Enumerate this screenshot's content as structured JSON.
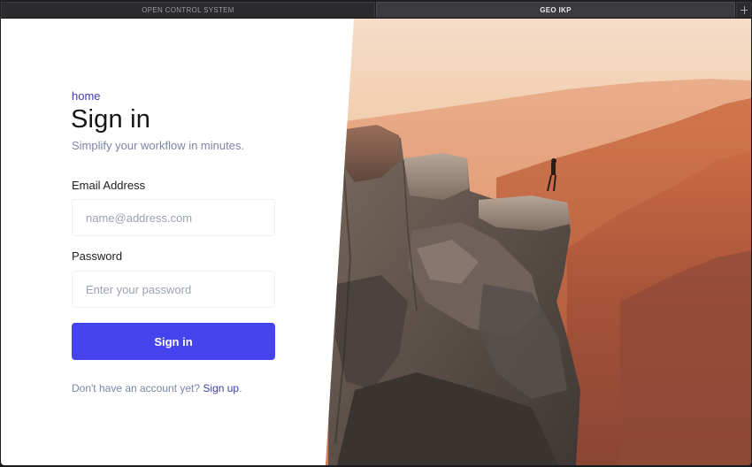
{
  "tabs": [
    {
      "label": "OPEN CONTROL SYSTEM",
      "active": false
    },
    {
      "label": "GEO IKP",
      "active": true
    }
  ],
  "icons": {
    "new_tab": "plus-icon"
  },
  "signin": {
    "breadcrumb": "home",
    "title": "Sign in",
    "subtitle": "Simplify your workflow in minutes.",
    "email_label": "Email Address",
    "email_placeholder": "name@address.com",
    "email_value": "",
    "password_label": "Password",
    "password_placeholder": "Enter your password",
    "password_value": "",
    "submit_label": "Sign in",
    "signup_prompt": "Don't have an account yet?",
    "signup_link": "Sign up",
    "signup_suffix": "."
  },
  "colors": {
    "accent": "#4543ee",
    "link": "#3d3fa8",
    "muted_text": "#7c86a6"
  }
}
